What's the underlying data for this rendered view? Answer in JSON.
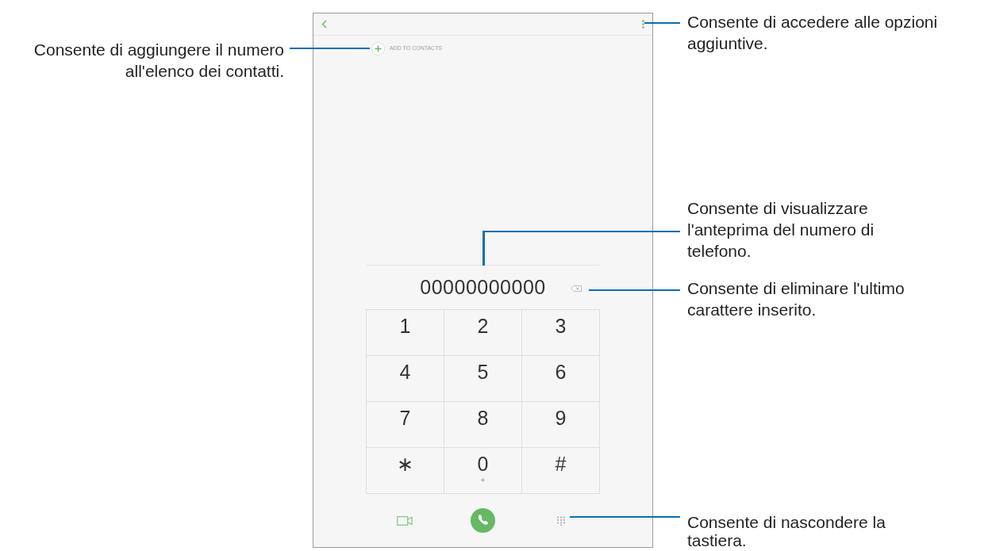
{
  "phone": {
    "add_contact_label": "ADD TO CONTACTS",
    "number": "00000000000",
    "keys": [
      {
        "digit": "1"
      },
      {
        "digit": "2"
      },
      {
        "digit": "3"
      },
      {
        "digit": "4"
      },
      {
        "digit": "5"
      },
      {
        "digit": "6"
      },
      {
        "digit": "7"
      },
      {
        "digit": "8"
      },
      {
        "digit": "9"
      },
      {
        "digit": "∗"
      },
      {
        "digit": "0",
        "letters": "+"
      },
      {
        "digit": "#"
      }
    ]
  },
  "callouts": [
    {
      "text": "Consente di aggiungere il numero all'elenco dei contatti."
    },
    {
      "text": "Consente di accedere alle opzioni aggiuntive."
    },
    {
      "text": "Consente di visualizzare l'anteprima del numero di telefono."
    },
    {
      "text": "Consente di eliminare l'ultimo carattere inserito."
    },
    {
      "text": "Consente di nascondere la tastiera."
    }
  ]
}
